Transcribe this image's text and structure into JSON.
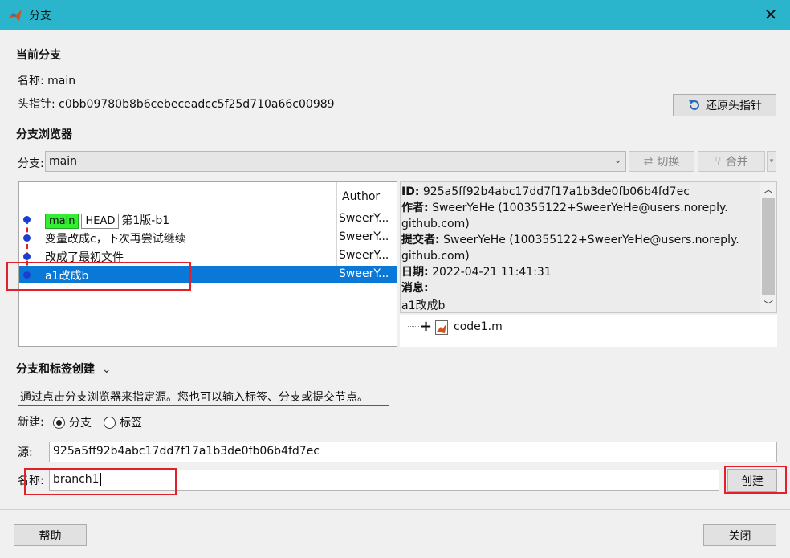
{
  "window": {
    "title": "分支"
  },
  "current_branch": {
    "heading": "当前分支",
    "name_label": "名称:",
    "name_value": "main",
    "head_label": "头指针:",
    "head_value": "c0bb09780b8b6cebeceadcc5f25d710a66c00989",
    "restore_button": "还原头指针"
  },
  "browser": {
    "heading": "分支浏览器",
    "branch_label": "分支:",
    "branch_selected": "main",
    "switch_button": "切换",
    "merge_button": "合并",
    "author_header": "Author",
    "commits": [
      {
        "badges": [
          "main",
          "HEAD"
        ],
        "message": "第1版-b1",
        "author": "SweerY..."
      },
      {
        "badges": [],
        "message": "变量改成c，下次再尝试继续",
        "author": "SweerY..."
      },
      {
        "badges": [],
        "message": "改成了最初文件",
        "author": "SweerY..."
      },
      {
        "badges": [],
        "message": "a1改成b",
        "author": "SweerY..."
      }
    ],
    "details": {
      "id_label": "ID:",
      "id_value": "925a5ff92b4abc17dd7f17a1b3de0fb06b4fd7ec",
      "author_label": "作者:",
      "author_value_1": "SweerYeHe (100355122+SweerYeHe@users.noreply.",
      "author_value_2": "github.com)",
      "committer_label": "提交者:",
      "committer_value_1": "SweerYeHe (100355122+SweerYeHe@users.noreply.",
      "committer_value_2": "github.com)",
      "date_label": "日期:",
      "date_value": "2022-04-21 11:41:31",
      "message_label": "消息:",
      "message_value": "a1改成b"
    },
    "files": [
      {
        "name": "code1.m"
      }
    ]
  },
  "create": {
    "heading": "分支和标签创建",
    "hint": "通过点击分支浏览器来指定源。您也可以输入标签、分支或提交节点。",
    "new_label": "新建:",
    "opt_branch": "分支",
    "opt_tag": "标签",
    "source_label": "源:",
    "source_value": "925a5ff92b4abc17dd7f17a1b3de0fb06b4fd7ec",
    "name_label": "名称:",
    "name_value": "branch1",
    "create_button": "创建"
  },
  "footer": {
    "help_button": "帮助",
    "close_button": "关闭"
  },
  "colors": {
    "titlebar": "#2bb5cc",
    "selection": "#0a78d7",
    "highlight_box": "#e0202a",
    "main_badge": "#33ee33"
  }
}
